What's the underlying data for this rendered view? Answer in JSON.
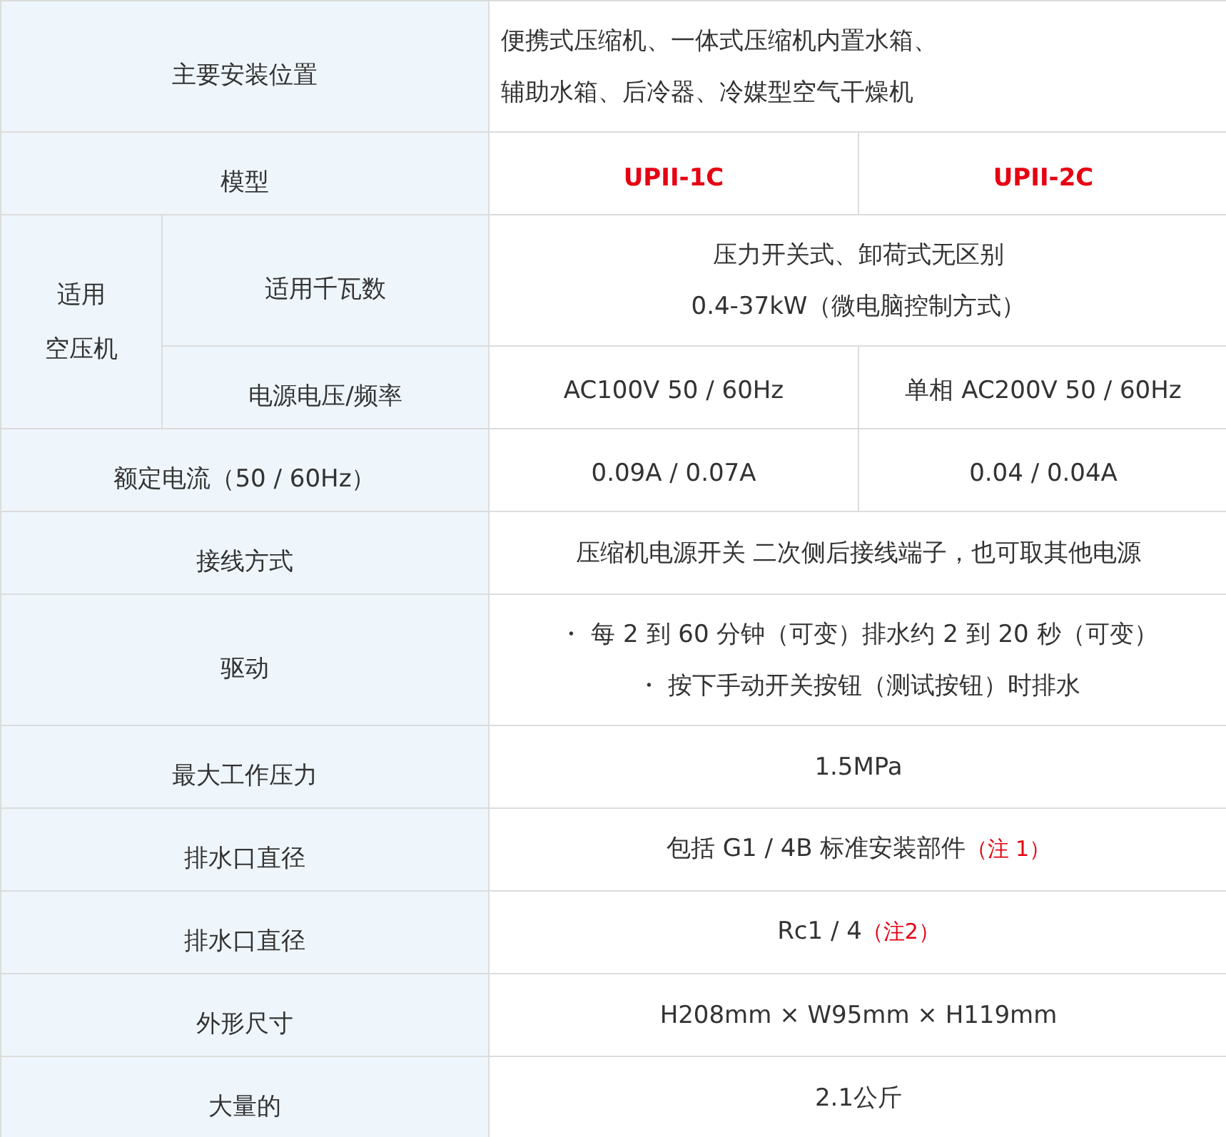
{
  "rows": [
    {
      "kind": "plain_left",
      "label": "主要安装位置",
      "value_lines": [
        "便携式压缩机、一体式压缩机内置水箱、",
        "辅助水箱、后冷器、冷媒型空气干燥机"
      ]
    },
    {
      "kind": "models",
      "label": "模型",
      "values": [
        "UPII-1C",
        "UPII-2C"
      ]
    },
    {
      "kind": "group",
      "label_lines": [
        "适用",
        "空压机"
      ],
      "children": [
        {
          "kind": "plain",
          "label": "适用千瓦数",
          "value_lines": [
            "压力开关式、卸荷式无区别",
            "0.4-37kW（微电脑控制方式）"
          ]
        },
        {
          "kind": "pair",
          "label": "电源电压/频率",
          "values": [
            "AC100V 50 / 60Hz",
            "单相 AC200V 50 / 60Hz"
          ]
        }
      ]
    },
    {
      "kind": "pair",
      "label": "额定电流（50 / 60Hz）",
      "values": [
        "0.09A / 0.07A",
        "0.04 / 0.04A"
      ]
    },
    {
      "kind": "plain",
      "label": "接线方式",
      "value_lines": [
        "压缩机电源开关 二次侧后接线端子，也可取其他电源"
      ]
    },
    {
      "kind": "plain",
      "label": "驱动",
      "value_lines": [
        "・ 每 2 到 60 分钟（可变）排水约 2 到 20 秒（可变）",
        "・ 按下手动开关按钮（测试按钮）时排水"
      ]
    },
    {
      "kind": "plain",
      "label": "最大工作压力",
      "value_lines": [
        "1.5MPa"
      ]
    },
    {
      "kind": "note",
      "label": "排水口直径",
      "value": "包括 G1 / 4B 标准安装部件",
      "note": "（注 1）"
    },
    {
      "kind": "note",
      "label": "排水口直径",
      "value": "Rc1 / 4",
      "note": "（注2）"
    },
    {
      "kind": "plain",
      "label": "外形尺寸",
      "value_lines": [
        "H208mm × W95mm × H119mm"
      ]
    },
    {
      "kind": "plain",
      "label": "大量的",
      "value_lines": [
        "2.1公斤"
      ]
    }
  ]
}
